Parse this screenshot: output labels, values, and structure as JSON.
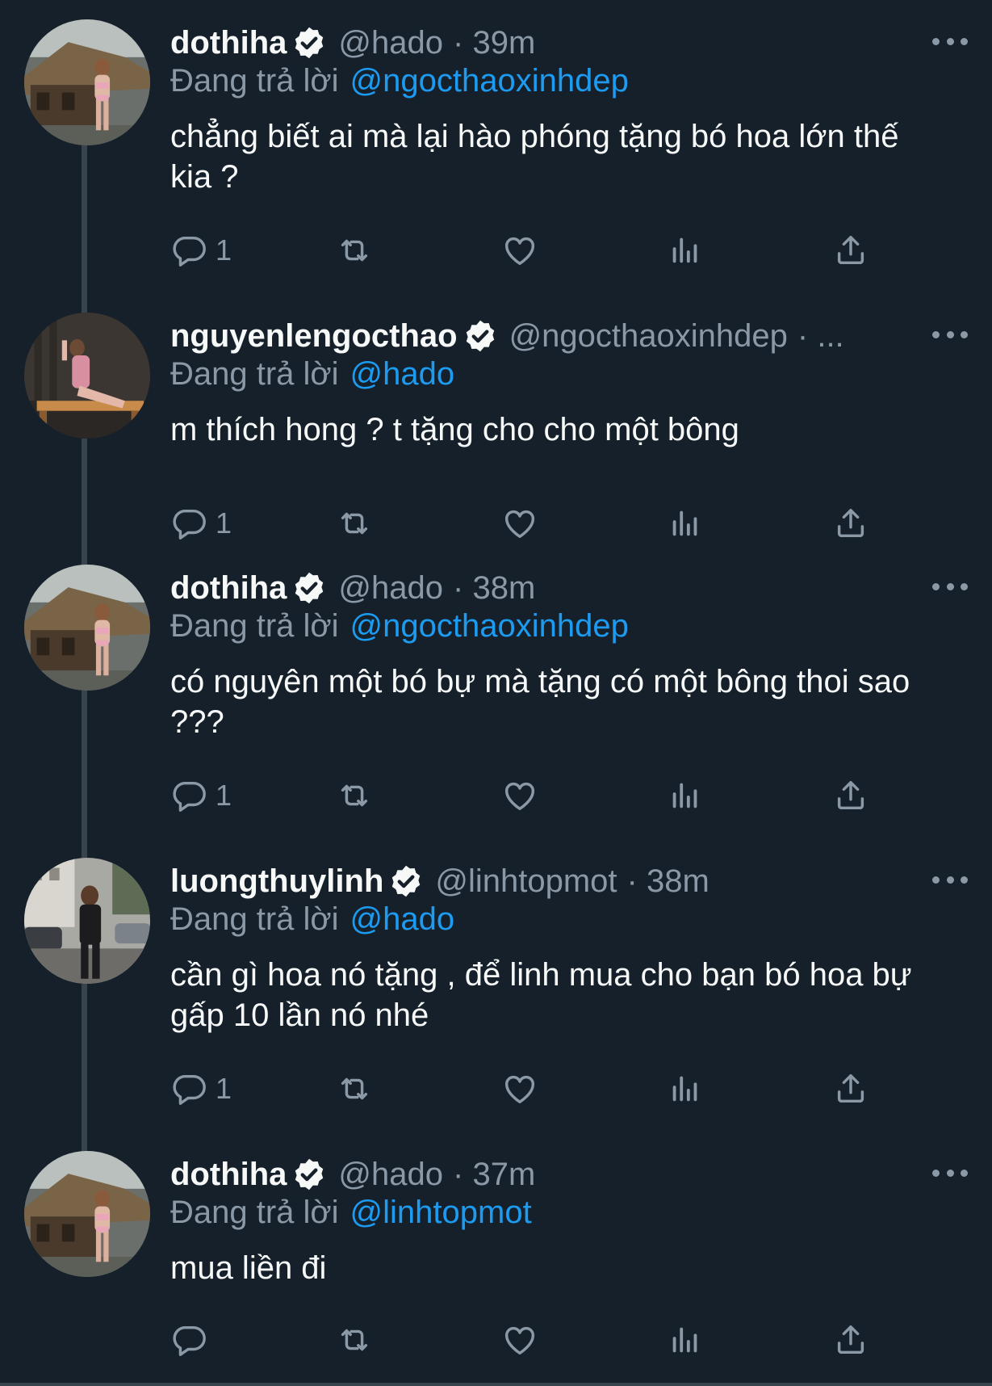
{
  "colors": {
    "background": "#15202b",
    "text_primary": "#f7f9f9",
    "text_secondary": "#8b98a5",
    "mention": "#1d9bf0",
    "verified": "#f7f9f9",
    "thread_line": "#38444d"
  },
  "tweets": [
    {
      "display_name": "dothiha",
      "handle": "@hado",
      "time": "· 39m",
      "reply_label": "Đang trả lời",
      "reply_to": "@ngocthaoxinhdep",
      "text": "chẳng biết ai mà lại hào phóng tặng bó hoa lớn thế kia ?",
      "reply_count": "1",
      "avatar": "avatar-dothiha"
    },
    {
      "display_name": "nguyenlengocthao",
      "handle": "@ngocthaoxinhdep",
      "time": "· ...",
      "reply_label": "Đang trả lời",
      "reply_to": "@hado",
      "text": "m thích hong ? t tặng cho cho một bông",
      "reply_count": "1",
      "avatar": "avatar-nguyenlengocthao"
    },
    {
      "display_name": "dothiha",
      "handle": "@hado",
      "time": "· 38m",
      "reply_label": "Đang trả lời",
      "reply_to": "@ngocthaoxinhdep",
      "text": "có nguyên một bó bự mà tặng có một bông thoi sao ???",
      "reply_count": "1",
      "avatar": "avatar-dothiha"
    },
    {
      "display_name": "luongthuylinh",
      "handle": "@linhtopmot",
      "time": "· 38m",
      "reply_label": "Đang trả lời",
      "reply_to": "@hado",
      "text": "cần gì hoa nó tặng , để linh mua cho bạn bó hoa bự gấp 10 lần nó nhé",
      "reply_count": "1",
      "avatar": "avatar-luongthuylinh"
    },
    {
      "display_name": "dothiha",
      "handle": "@hado",
      "time": "· 37m",
      "reply_label": "Đang trả lời",
      "reply_to": "@linhtopmot",
      "text": "mua liền đi",
      "reply_count": "",
      "avatar": "avatar-dothiha"
    }
  ],
  "icons": {
    "reply": "reply-icon",
    "retweet": "retweet-icon",
    "like": "like-icon",
    "views": "views-icon",
    "share": "share-icon",
    "more": "more-icon",
    "verified": "verified-badge-icon"
  }
}
